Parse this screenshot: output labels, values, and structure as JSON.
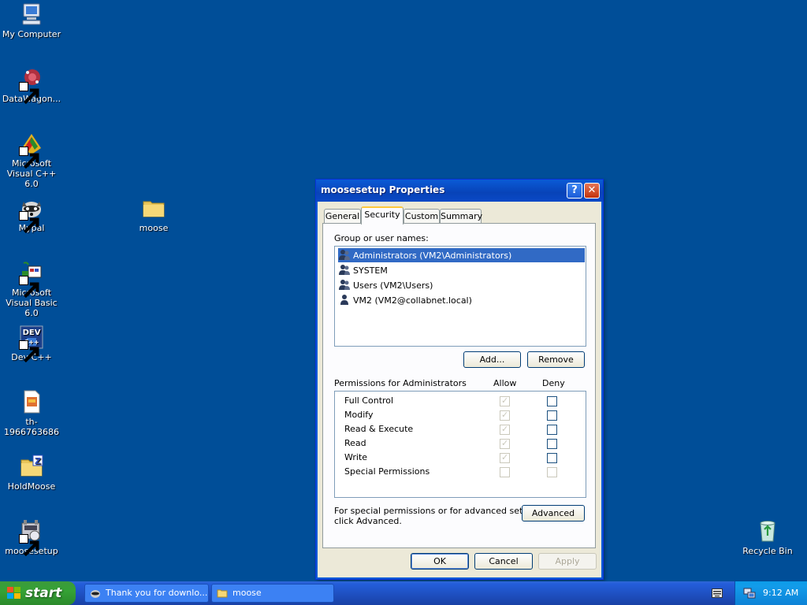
{
  "desktop": {
    "icons": [
      {
        "label": "My Computer",
        "icon": "my-computer-icon"
      },
      {
        "label": "DataWagon...",
        "icon": "datawagon-icon"
      },
      {
        "label": "Microsoft Visual C++ 6.0",
        "icon": "visual-cpp-icon"
      },
      {
        "label": "Mypal",
        "icon": "mypal-icon"
      },
      {
        "label": "moose",
        "icon": "folder-icon"
      },
      {
        "label": "Microsoft Visual Basic 6.0",
        "icon": "visual-basic-icon"
      },
      {
        "label": "Dev-C++",
        "icon": "devcpp-icon"
      },
      {
        "label": "th-1966763686",
        "icon": "image-file-icon"
      },
      {
        "label": "HoldMoose",
        "icon": "zip-folder-icon"
      },
      {
        "label": "moosesetup",
        "icon": "installer-icon"
      },
      {
        "label": "Recycle Bin",
        "icon": "recycle-bin-icon"
      }
    ]
  },
  "dialog": {
    "title": "moosesetup Properties",
    "help_glyph": "?",
    "close_glyph": "✕",
    "tabs": [
      {
        "label": "General",
        "active": false
      },
      {
        "label": "Security",
        "active": true
      },
      {
        "label": "Custom",
        "active": false
      },
      {
        "label": "Summary",
        "active": false
      }
    ],
    "group_label": "Group or user names:",
    "users": [
      {
        "name": "Administrators (VM2\\Administrators)",
        "selected": true,
        "icon": "user-group-icon"
      },
      {
        "name": "SYSTEM",
        "selected": false,
        "icon": "user-group-icon"
      },
      {
        "name": "Users (VM2\\Users)",
        "selected": false,
        "icon": "user-group-icon"
      },
      {
        "name": "VM2 (VM2@collabnet.local)",
        "selected": false,
        "icon": "user-icon"
      }
    ],
    "add_label": "Add...",
    "remove_label": "Remove",
    "permissions_label": "Permissions for Administrators",
    "allow_label": "Allow",
    "deny_label": "Deny",
    "permissions": [
      {
        "name": "Full Control",
        "allow": true,
        "allow_disabled": true,
        "deny": false,
        "deny_disabled": false
      },
      {
        "name": "Modify",
        "allow": true,
        "allow_disabled": true,
        "deny": false,
        "deny_disabled": false
      },
      {
        "name": "Read & Execute",
        "allow": true,
        "allow_disabled": true,
        "deny": false,
        "deny_disabled": false
      },
      {
        "name": "Read",
        "allow": true,
        "allow_disabled": true,
        "deny": false,
        "deny_disabled": false
      },
      {
        "name": "Write",
        "allow": true,
        "allow_disabled": true,
        "deny": false,
        "deny_disabled": false
      },
      {
        "name": "Special Permissions",
        "allow": false,
        "allow_disabled": true,
        "deny": false,
        "deny_disabled": true
      }
    ],
    "advanced_note_line1": "For special permissions or for advanced settings,",
    "advanced_note_line2": "click Advanced.",
    "advanced_label": "Advanced",
    "ok_label": "OK",
    "cancel_label": "Cancel",
    "apply_label": "Apply"
  },
  "taskbar": {
    "start_label": "start",
    "tasks": [
      {
        "label": "Thank you for downlo...",
        "icon": "browser-icon"
      },
      {
        "label": "moose",
        "icon": "folder-icon"
      }
    ],
    "clock": "9:12 AM"
  },
  "colors": {
    "desktop": "#004e98",
    "selection": "#316ac5",
    "titlebar": "#0a5bd6"
  }
}
